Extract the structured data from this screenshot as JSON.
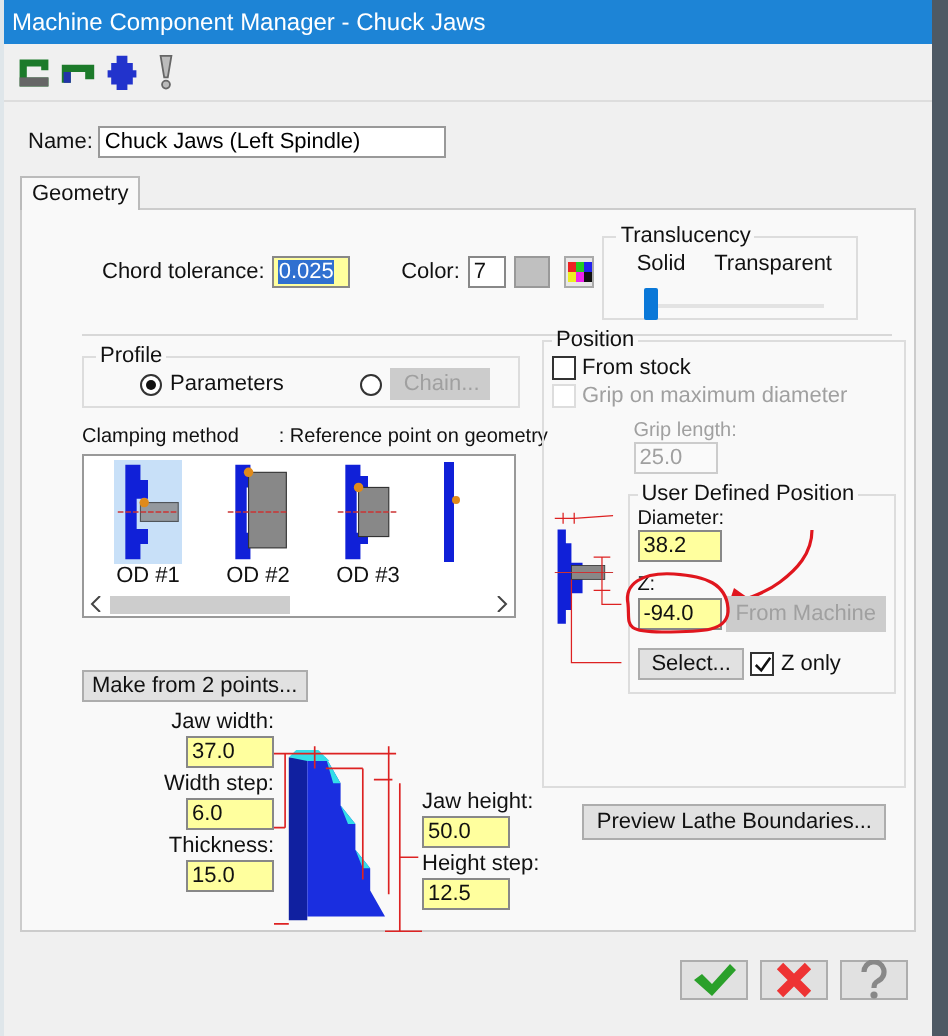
{
  "window": {
    "title": "Machine Component Manager - Chuck Jaws"
  },
  "name": {
    "label": "Name:",
    "value": "Chuck Jaws (Left Spindle)"
  },
  "tabs": [
    {
      "label": "Geometry",
      "selected": true
    }
  ],
  "chord_tolerance": {
    "label": "Chord tolerance:",
    "value": "0.025",
    "text_selected": true
  },
  "color": {
    "label": "Color:",
    "value": "7"
  },
  "translucency": {
    "title": "Translucency",
    "min_label": "Solid",
    "max_label": "Transparent",
    "level": 0
  },
  "profile": {
    "title": "Profile",
    "options": [
      {
        "kind": "label",
        "label": "Parameters",
        "selected": true,
        "disabled": false
      },
      {
        "kind": "button",
        "label": "Chain...",
        "selected": false,
        "disabled": true
      }
    ]
  },
  "clamping": {
    "title": "Clamping method",
    "legend": ": Reference point on geometry",
    "items": [
      {
        "label": "OD #1",
        "selected": true
      },
      {
        "label": "OD #2",
        "selected": false
      },
      {
        "label": "OD #3",
        "selected": false
      }
    ]
  },
  "make_button": {
    "label": "Make from 2 points..."
  },
  "jaw": {
    "left_fields": [
      {
        "label": "Jaw width:",
        "value": "37.0"
      },
      {
        "label": "Width step:",
        "value": "6.0"
      },
      {
        "label": "Thickness:",
        "value": "15.0"
      }
    ],
    "right_fields": [
      {
        "label": "Jaw height:",
        "value": "50.0"
      },
      {
        "label": "Height step:",
        "value": "12.5"
      }
    ]
  },
  "position": {
    "title": "Position",
    "checkboxes": [
      {
        "label": "From stock",
        "checked": false,
        "disabled": false
      },
      {
        "label": "Grip on maximum diameter",
        "checked": false,
        "disabled": true
      }
    ],
    "grip_length": {
      "label": "Grip length:",
      "value": "25.0",
      "disabled": true
    },
    "user_defined": {
      "title": "User Defined Position",
      "diameter": {
        "label": "Diameter:",
        "value": "38.2"
      },
      "z": {
        "label": "Z:",
        "value": "-94.0"
      },
      "from_machine": {
        "label": "From Machine",
        "disabled": true
      },
      "select": {
        "label": "Select..."
      },
      "z_only": {
        "label": "Z only",
        "checked": true
      }
    }
  },
  "preview_button": {
    "label": "Preview Lathe Boundaries..."
  }
}
